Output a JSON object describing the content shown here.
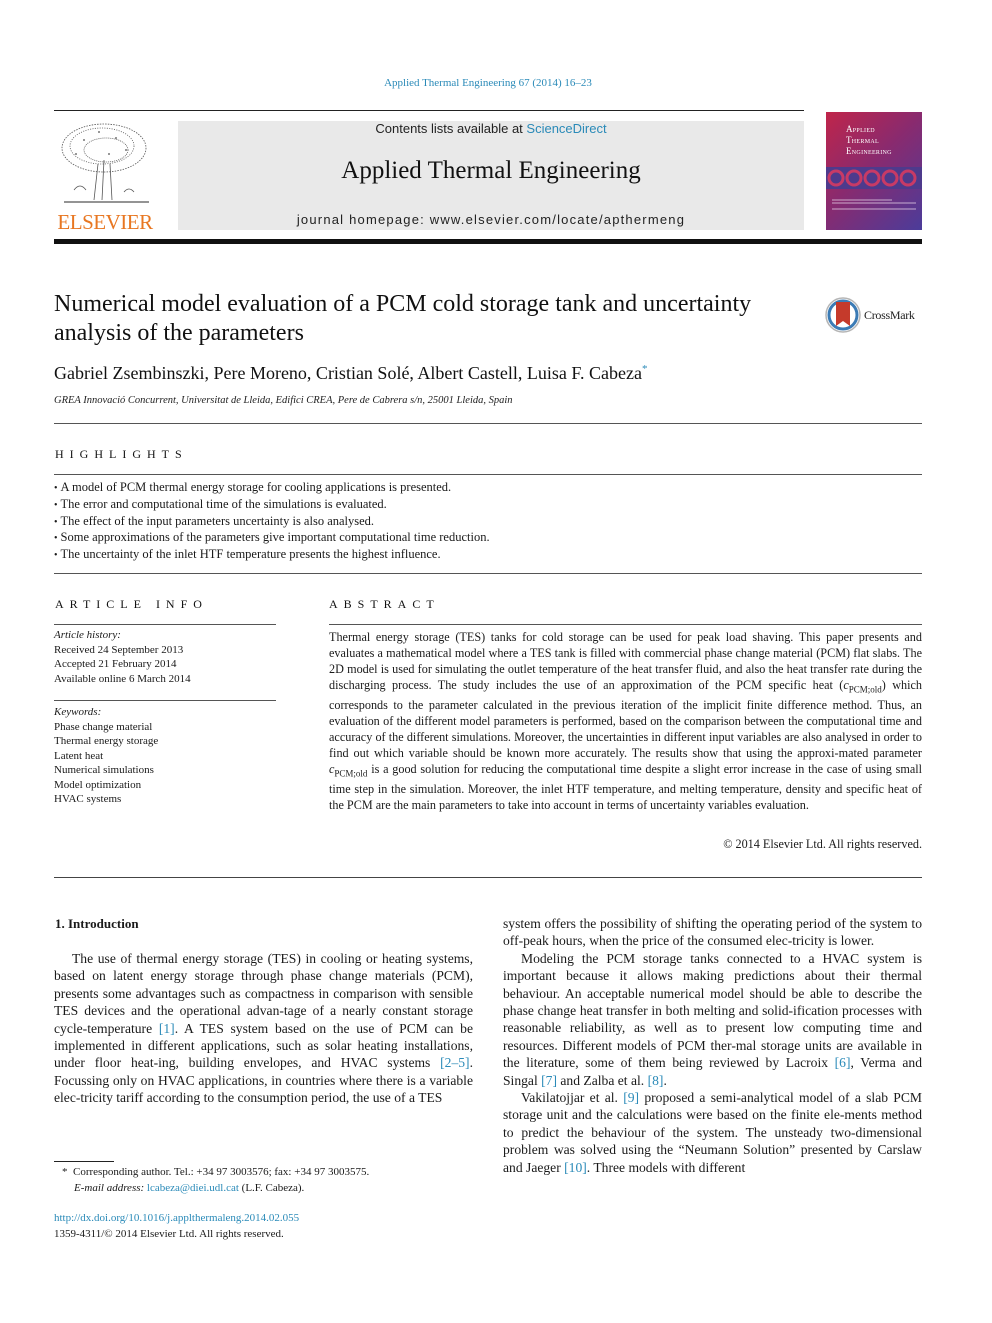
{
  "header": {
    "journal_ref": "Applied Thermal Engineering 67 (2014) 16–23",
    "publisher_name": "ELSEVIER",
    "contents_prefix": "Contents lists available at ",
    "contents_link": "ScienceDirect",
    "journal_name": "Applied Thermal Engineering",
    "homepage": "journal homepage: www.elsevier.com/locate/apthermeng",
    "cover_title_lines": [
      "Applied",
      "Thermal",
      "Engineering"
    ],
    "crossmark_label": "CrossMark"
  },
  "article": {
    "title": "Numerical model evaluation of a PCM cold storage tank and uncertainty analysis of the parameters",
    "authors": "Gabriel Zsembinszki, Pere Moreno, Cristian Solé, Albert Castell, Luisa F. Cabeza",
    "corresponding_mark": "*",
    "affiliation": "GREA Innovació Concurrent, Universitat de Lleida, Edifici CREA, Pere de Cabrera s/n, 25001 Lleida, Spain"
  },
  "highlights": {
    "title": "HIGHLIGHTS",
    "items": [
      "A model of PCM thermal energy storage for cooling applications is presented.",
      "The error and computational time of the simulations is evaluated.",
      "The effect of the input parameters uncertainty is also analysed.",
      "Some approximations of the parameters give important computational time reduction.",
      "The uncertainty of the inlet HTF temperature presents the highest influence."
    ]
  },
  "article_info": {
    "title": "ARTICLE INFO",
    "history_label": "Article history:",
    "history": [
      "Received 24 September 2013",
      "Accepted 21 February 2014",
      "Available online 6 March 2014"
    ],
    "keywords_label": "Keywords:",
    "keywords": [
      "Phase change material",
      "Thermal energy storage",
      "Latent heat",
      "Numerical simulations",
      "Model optimization",
      "HVAC systems"
    ]
  },
  "abstract": {
    "title": "ABSTRACT",
    "text_part1": "Thermal energy storage (TES) tanks for cold storage can be used for peak load shaving. This paper presents and evaluates a mathematical model where a TES tank is filled with commercial phase change material (PCM) flat slabs. The 2D model is used for simulating the outlet temperature of the heat transfer fluid, and also the heat transfer rate during the discharging process. The study includes the use of an approximation of the PCM specific heat (",
    "symbol": "c",
    "symbol_sub": "PCM;old",
    "text_part2": ") which corresponds to the parameter calculated in the previous iteration of the implicit finite difference method. Thus, an evaluation of the different model parameters is performed, based on the comparison between the computational time and accuracy of the different simulations. Moreover, the uncertainties in different input variables are also analysed in order to find out which variable should be known more accurately. The results show that using the approxi-mated parameter ",
    "text_part3": " is a good solution for reducing the computational time despite a slight error increase in the case of using small time step in the simulation. Moreover, the inlet HTF temperature, and melting temperature, density and specific heat of the PCM are the main parameters to take into account in terms of uncertainty variables evaluation.",
    "copyright": "© 2014 Elsevier Ltd. All rights reserved."
  },
  "body": {
    "intro_heading": "1.  Introduction",
    "left_p1_a": "The use of thermal energy storage (TES) in cooling or heating systems, based on latent energy storage through phase change materials (PCM), presents some advantages such as compactness in comparison with sensible TES devices and the operational advan-tage of a nearly constant storage cycle-temperature ",
    "ref1": "[1]",
    "left_p1_b": ". A TES system based on the use of PCM can be implemented in different applications, such as solar heating installations, under floor heat-ing, building envelopes, and HVAC systems ",
    "ref2": "[2–5]",
    "left_p1_c": ". Focussing only on HVAC applications, in countries where there is a variable elec-tricity tariff according to the consumption period, the use of a TES",
    "right_p1": "system offers the possibility of shifting the operating period of the system to off-peak hours, when the price of the consumed elec-tricity is lower.",
    "right_p2_a": "Modeling the PCM storage tanks connected to a HVAC system is important because it allows making predictions about their thermal behaviour. An acceptable numerical model should be able to describe the phase change heat transfer in both melting and solid-ification processes with reasonable reliability, as well as to present low computing time and resources. Different models of PCM ther-mal storage units are available in the literature, some of them being reviewed by Lacroix ",
    "ref6": "[6]",
    "right_p2_b": ", Verma and Singal ",
    "ref7": "[7]",
    "right_p2_c": " and Zalba et al. ",
    "ref8": "[8]",
    "right_p2_d": ".",
    "right_p3_a": "Vakilatojjar et al. ",
    "ref9": "[9]",
    "right_p3_b": " proposed a semi-analytical model of a slab PCM storage unit and the calculations were based on the finite ele-ments method to predict the behaviour of the system. The unsteady two-dimensional problem was solved using the “Neumann Solution” presented by Carslaw and Jaeger ",
    "ref10": "[10]",
    "right_p3_c": ". Three models with different"
  },
  "footer": {
    "footnote_mark": "*",
    "footnote_text": "Corresponding author. Tel.: +34 97 3003576; fax: +34 97 3003575.",
    "email_label": "E-mail address:",
    "email": "lcabeza@diei.udl.cat",
    "email_suffix": " (L.F. Cabeza).",
    "doi": "http://dx.doi.org/10.1016/j.applthermaleng.2014.02.055",
    "issn_copyright": "1359-4311/© 2014 Elsevier Ltd. All rights reserved."
  },
  "colors": {
    "link": "#2a8ab8",
    "elsevier_orange": "#e87722",
    "masthead_bg": "#e9e9e9"
  }
}
